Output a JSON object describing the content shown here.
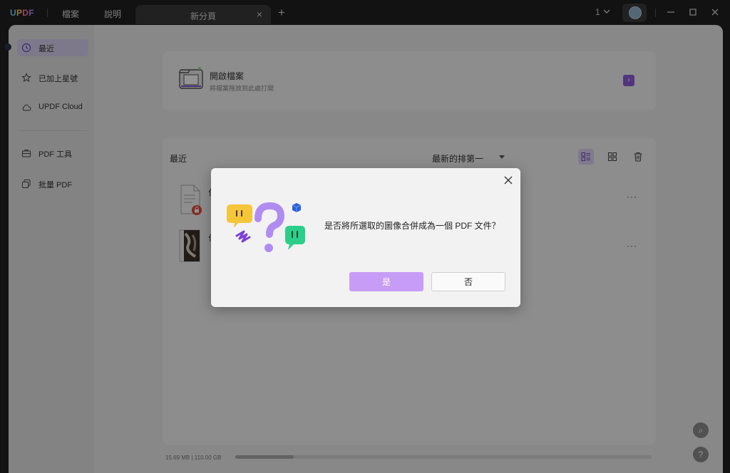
{
  "titlebar": {
    "logo": {
      "u": "U",
      "p": "P",
      "d": "D",
      "f": "F"
    },
    "menu_file": "檔案",
    "menu_help": "說明",
    "tab_label": "新分頁",
    "tab_add": "+",
    "tab_close": "×",
    "page_count": "1"
  },
  "sidebar": {
    "items": [
      {
        "label": "最近"
      },
      {
        "label": "已加上星號"
      },
      {
        "label": "UPDF Cloud"
      },
      {
        "label": "PDF 工具"
      },
      {
        "label": "批量 PDF"
      }
    ]
  },
  "open_card": {
    "title": "開啟檔案",
    "subtitle": "將檔案拖放到此處打開",
    "arrow": "›"
  },
  "recent": {
    "title": "最近",
    "sort_label": "最新的排第一",
    "files": [
      {
        "name": "化",
        "more": "···"
      },
      {
        "name": "化",
        "more": "···"
      }
    ]
  },
  "storage": {
    "text": "15.69 MB | 110.00 GB",
    "used_fraction": 0.14
  },
  "floating": {
    "search": "⌕",
    "help": "?"
  },
  "dialog": {
    "message": "是否將所選取的圖像合併成為一個 PDF 文件？",
    "yes_label": "是",
    "no_label": "否"
  },
  "colors": {
    "accent": "#8d5cd9",
    "primary_button": "#c79cf6",
    "active_nav": "#d8d0f0"
  }
}
